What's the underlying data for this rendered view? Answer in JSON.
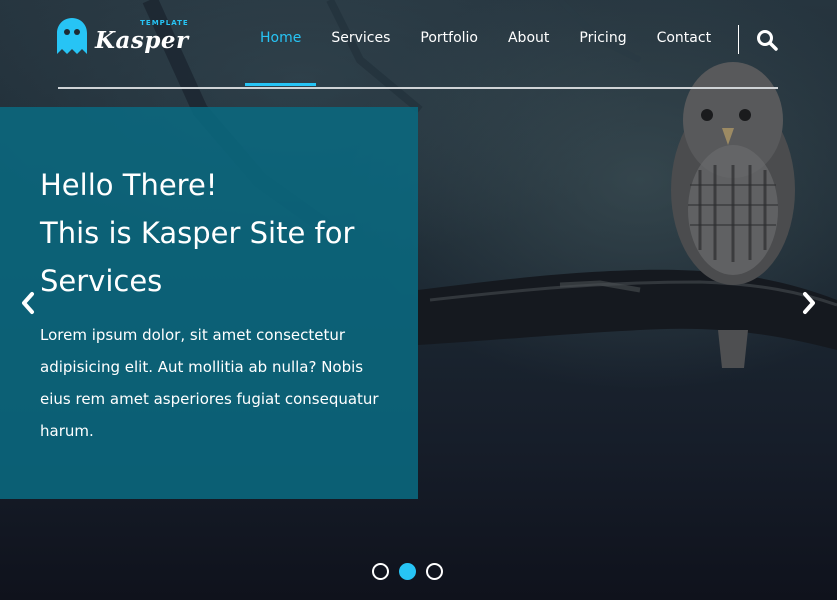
{
  "brand": {
    "tag": "TEMPLATE",
    "name": "Kasper",
    "accent_color": "#27c4f5"
  },
  "nav": {
    "items": [
      {
        "label": "Home",
        "active": true
      },
      {
        "label": "Services",
        "active": false
      },
      {
        "label": "Portfolio",
        "active": false
      },
      {
        "label": "About",
        "active": false
      },
      {
        "label": "Pricing",
        "active": false
      },
      {
        "label": "Contact",
        "active": false
      }
    ],
    "search_icon": "search-icon"
  },
  "hero": {
    "heading_line1": "Hello There!",
    "heading_line2": "This is Kasper Site for",
    "heading_line3": "Services",
    "paragraph": "Lorem ipsum dolor, sit amet consectetur adipisicing elit. Aut mollitia ab nulla? Nobis eius rem amet asperiores fugiat consequatur harum.",
    "panel_color": "#0a6980",
    "prev_icon": "chevron-left-icon",
    "next_icon": "chevron-right-icon",
    "slides": 3,
    "active_slide": 2
  }
}
